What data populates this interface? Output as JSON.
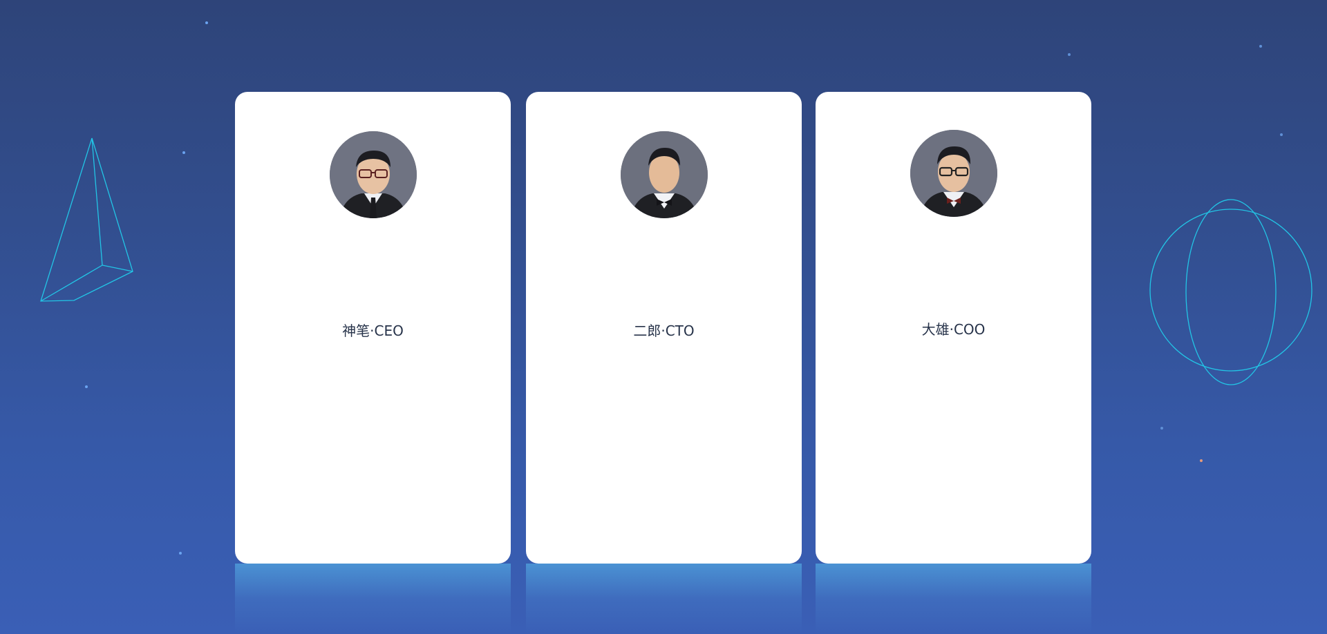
{
  "cards": [
    {
      "name": "神笔·CEO",
      "avatar_icon": "person-glasses-tie-icon"
    },
    {
      "name": "二郎·CTO",
      "avatar_icon": "person-bowtie-icon"
    },
    {
      "name": "大雄·COO",
      "avatar_icon": "person-glasses-bowtie-icon"
    }
  ],
  "colors": {
    "background_top": "#2e4479",
    "background_bottom": "#3a5fb6",
    "card": "#ffffff",
    "line_art": "#22c6e6",
    "name_text": "#27334a"
  }
}
